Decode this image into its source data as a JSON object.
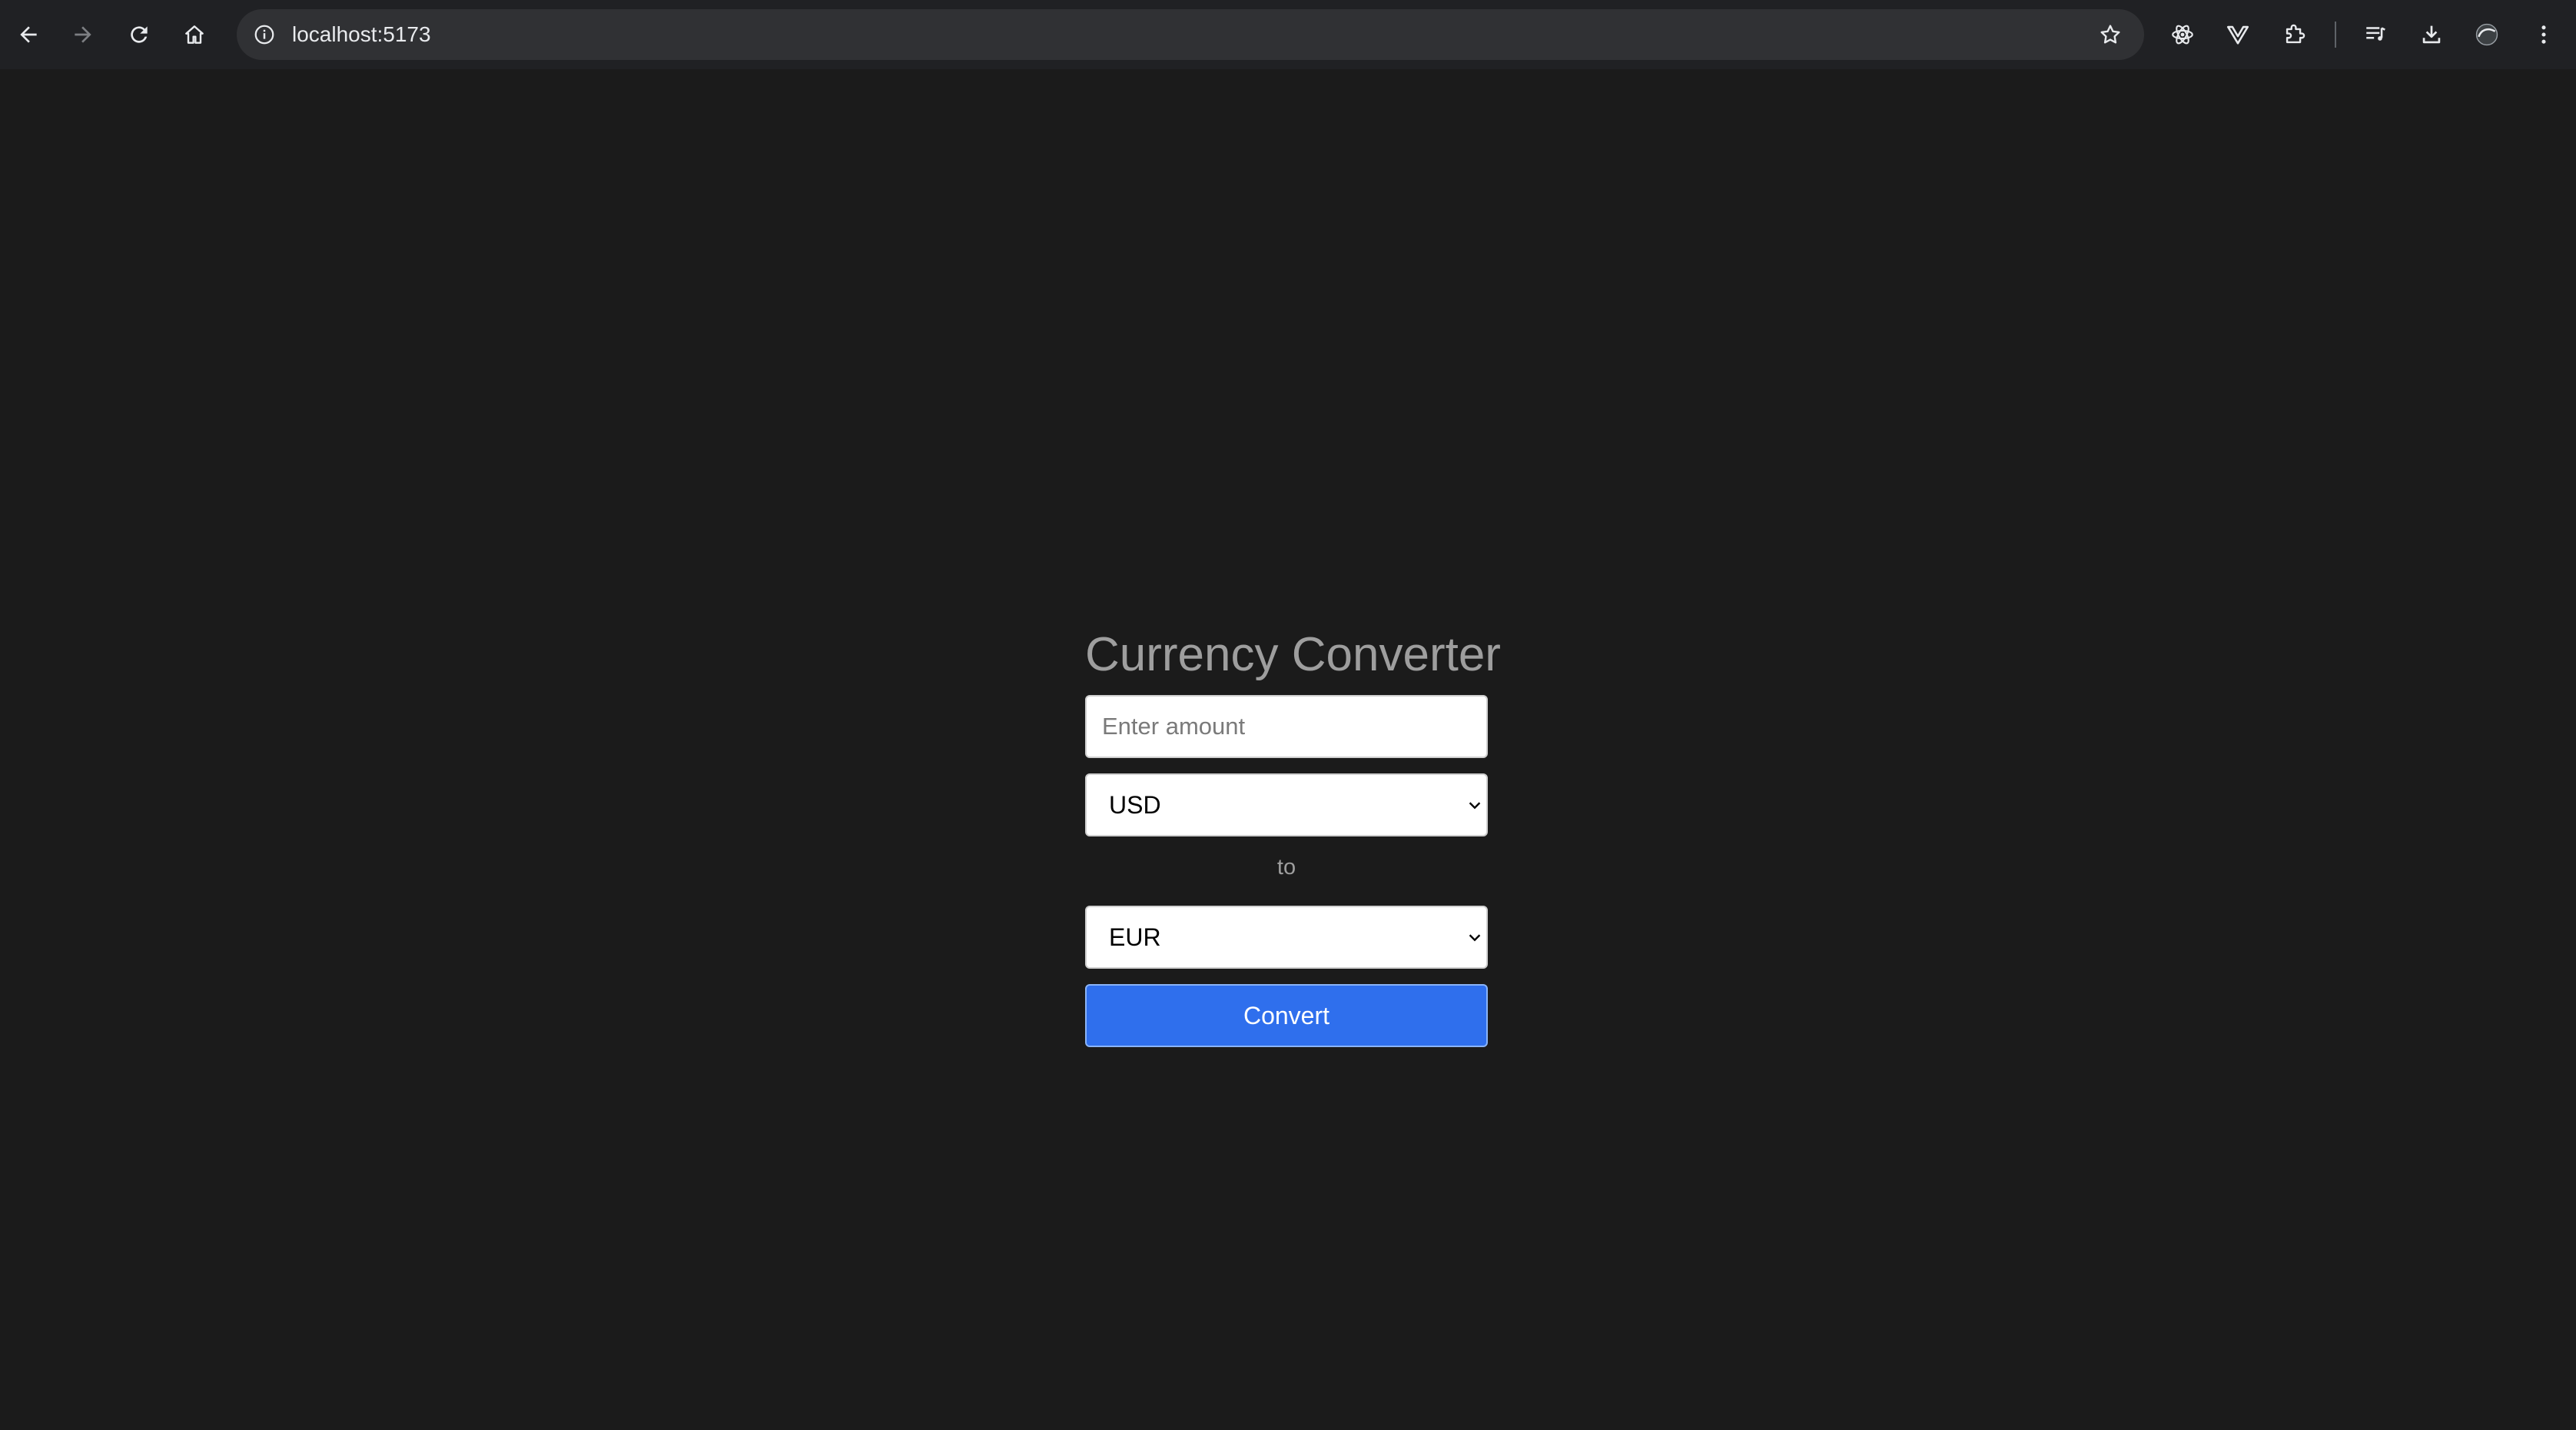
{
  "browser": {
    "url": "localhost:5173",
    "icons": {
      "back": "arrow-left-icon",
      "forward": "arrow-right-icon",
      "reload": "reload-icon",
      "home": "home-icon",
      "site_info": "info-icon",
      "bookmark": "star-icon",
      "extensions": [
        "react-icon",
        "vue-icon",
        "puzzle-icon",
        "media-list-icon",
        "download-icon",
        "profile-icon",
        "menu-icon"
      ]
    }
  },
  "app": {
    "title": "Currency Converter",
    "amount": {
      "value": "",
      "placeholder": "Enter amount"
    },
    "from_currency": "USD",
    "separator": "to",
    "to_currency": "EUR",
    "convert_label": "Convert"
  },
  "colors": {
    "background": "#1b1b1b",
    "accent": "#2f6fed",
    "text_muted": "#9e9e9e"
  }
}
